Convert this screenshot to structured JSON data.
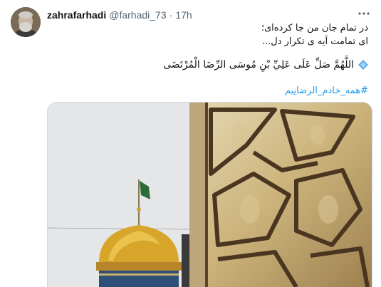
{
  "tweet": {
    "author_name": "zahrafarhadi",
    "author_handle": "@farhadi_73",
    "separator": "·",
    "time": "17h",
    "more_icon": "more-dots-icon",
    "line1": "در تمام جان من جا کرده‌ای؛",
    "line2": "ای تمامت آیه ی تکرار دل...",
    "prayer": "اللَّهُمَّ صَلِّ عَلَى عَلِيِّ بْنِ مُوسَى الرِّضَا الْمُرْتَضَى",
    "prayer_icon": "blue-diamond-icon",
    "hashtag": "#همه_خادم_الرضاییم",
    "link_color": "#1d9bf0"
  },
  "media": {
    "left_image": "golden-dome-with-green-flag-image",
    "right_image": "carved-golden-door-image"
  }
}
